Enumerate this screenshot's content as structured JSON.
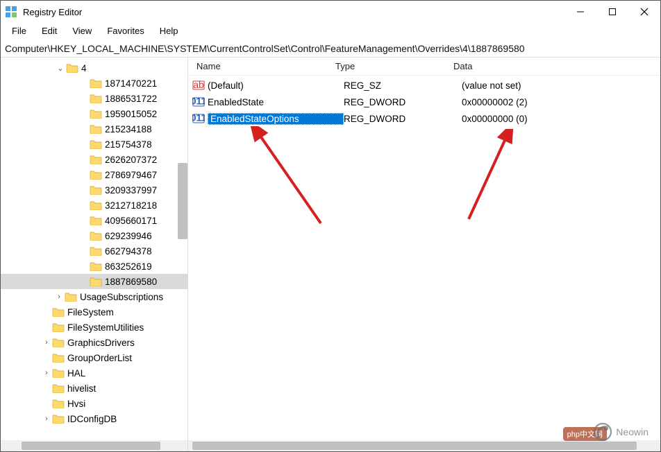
{
  "window": {
    "title": "Registry Editor"
  },
  "menu": {
    "items": [
      "File",
      "Edit",
      "View",
      "Favorites",
      "Help"
    ]
  },
  "address": "Computer\\HKEY_LOCAL_MACHINE\\SYSTEM\\CurrentControlSet\\Control\\FeatureManagement\\Overrides\\4\\1887869580",
  "tree": {
    "four_label": "4",
    "four_children": [
      "1871470221",
      "1886531722",
      "1959015052",
      "215234188",
      "215754378",
      "2626207372",
      "2786979467",
      "3209337997",
      "3212718218",
      "4095660171",
      "629239946",
      "662794378",
      "863252619",
      "1887869580"
    ],
    "selected": "1887869580",
    "after_four": [
      {
        "label": "UsageSubscriptions",
        "expander": "›",
        "indent": 76
      },
      {
        "label": "FileSystem",
        "expander": "",
        "indent": 58
      },
      {
        "label": "FileSystemUtilities",
        "expander": "",
        "indent": 58
      },
      {
        "label": "GraphicsDrivers",
        "expander": "›",
        "indent": 58
      },
      {
        "label": "GroupOrderList",
        "expander": "",
        "indent": 58
      },
      {
        "label": "HAL",
        "expander": "›",
        "indent": 58
      },
      {
        "label": "hivelist",
        "expander": "",
        "indent": 58
      },
      {
        "label": "Hvsi",
        "expander": "",
        "indent": 58
      },
      {
        "label": "IDConfigDB",
        "expander": "›",
        "indent": 58
      }
    ]
  },
  "list": {
    "columns": {
      "name": "Name",
      "type": "Type",
      "data": "Data"
    },
    "rows": [
      {
        "icon": "string",
        "name": "(Default)",
        "type": "REG_SZ",
        "data": "(value not set)",
        "selected": false
      },
      {
        "icon": "dword",
        "name": "EnabledState",
        "type": "REG_DWORD",
        "data": "0x00000002 (2)",
        "selected": false
      },
      {
        "icon": "dword",
        "name": "EnabledStateOptions",
        "type": "REG_DWORD",
        "data": "0x00000000 (0)",
        "selected": true
      }
    ]
  },
  "watermark": {
    "text": "Neowin",
    "badge": "php中文网"
  }
}
